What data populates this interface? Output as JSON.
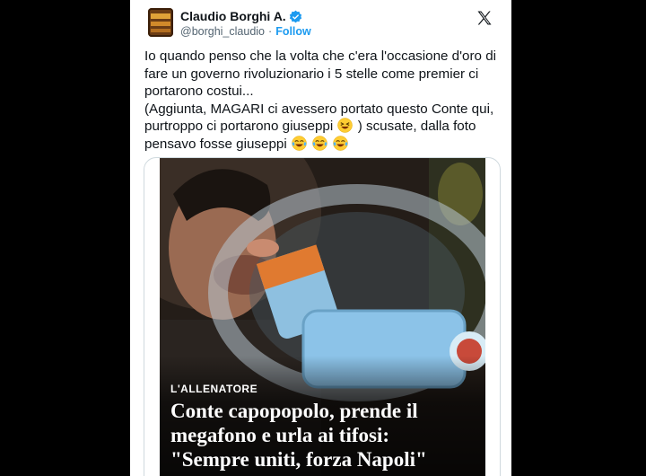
{
  "tweet": {
    "author_name": "Claudio Borghi A.",
    "handle": "@borghi_claudio",
    "separator": "·",
    "follow_label": "Follow",
    "text_lines": [
      "Io quando penso che la volta che c'era l'occasione d'oro di",
      "fare un governo rivoluzionario i 5 stelle come premier ci",
      "portarono costui...",
      "(Aggiunta, MAGARI ci avessero portato questo Conte qui,",
      "purtroppo ci portarono giuseppi",
      ") scusate, dalla foto",
      "pensavo fosse giuseppi"
    ]
  },
  "media": {
    "kicker": "L'ALLENATORE",
    "headline_lines": [
      "Conte capopopolo, prende il",
      "megafono e urla ai tifosi:",
      "\"Sempre uniti, forza Napoli\""
    ]
  },
  "icons": {
    "verified": "verified-badge-icon",
    "x_logo": "x-logo-icon",
    "laughing_face": "grinning-squinting-face-emoji",
    "tears_of_joy": "face-with-tears-of-joy-emoji"
  },
  "colors": {
    "follow_blue": "#1d9bf0",
    "handle_gray": "#536471",
    "text": "#0f1419",
    "border": "#cfd9de"
  }
}
